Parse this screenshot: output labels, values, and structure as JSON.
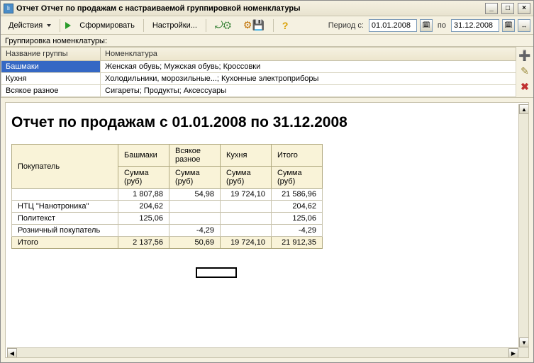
{
  "window": {
    "title": "Отчет  Отчет по продажам с настраиваемой группировкой номенклатуры"
  },
  "toolbar": {
    "actions_label": "Действия",
    "form_label": "Сформировать",
    "settings_label": "Настройки...",
    "period_label": "Период с:",
    "period_to": "по",
    "date_from": "01.01.2008",
    "date_to": "31.12.2008"
  },
  "grouping": {
    "caption": "Группировка номенклатуры:",
    "col_group": "Название группы",
    "col_nomen": "Номенклатура",
    "rows": [
      {
        "name": "Башмаки",
        "items": "Женская обувь; Мужская обувь; Кроссовки"
      },
      {
        "name": "Кухня",
        "items": "Холодильники, морозильные...; Кухонные электроприборы"
      },
      {
        "name": "Всякое разное",
        "items": "Сигареты; Продукты; Аксессуары"
      }
    ]
  },
  "report": {
    "title": "Отчет по продажам с 01.01.2008 по 31.12.2008",
    "buyer_header": "Покупатель",
    "sum_label": "Сумма (руб)",
    "columns": [
      "Башмаки",
      "Всякое разное",
      "Кухня",
      "Итого"
    ],
    "rows": [
      {
        "buyer": "",
        "vals": [
          "1 807,88",
          "54,98",
          "19 724,10",
          "21 586,96"
        ]
      },
      {
        "buyer": "НТЦ \"Нанотроника\"",
        "vals": [
          "204,62",
          "",
          "",
          "204,62"
        ]
      },
      {
        "buyer": "Политекст",
        "vals": [
          "125,06",
          "",
          "",
          "125,06"
        ]
      },
      {
        "buyer": "Розничный покупатель",
        "vals": [
          "",
          "-4,29",
          "",
          "-4,29"
        ]
      }
    ],
    "total_label": "Итого",
    "totals": [
      "2 137,56",
      "50,69",
      "19 724,10",
      "21 912,35"
    ]
  },
  "chart_data": {
    "type": "table",
    "title": "Отчет по продажам с 01.01.2008 по 31.12.2008",
    "row_field": "Покупатель",
    "value_label": "Сумма (руб)",
    "columns": [
      "Башмаки",
      "Всякое разное",
      "Кухня",
      "Итого"
    ],
    "rows": [
      {
        "buyer": "(пусто)",
        "Башмаки": 1807.88,
        "Всякое разное": 54.98,
        "Кухня": 19724.1,
        "Итого": 21586.96
      },
      {
        "buyer": "НТЦ \"Нанотроника\"",
        "Башмаки": 204.62,
        "Всякое разное": null,
        "Кухня": null,
        "Итого": 204.62
      },
      {
        "buyer": "Политекст",
        "Башмаки": 125.06,
        "Всякое разное": null,
        "Кухня": null,
        "Итого": 125.06
      },
      {
        "buyer": "Розничный покупатель",
        "Башмаки": null,
        "Всякое разное": -4.29,
        "Кухня": null,
        "Итого": -4.29
      }
    ],
    "totals": {
      "Башмаки": 2137.56,
      "Всякое разное": 50.69,
      "Кухня": 19724.1,
      "Итого": 21912.35
    }
  }
}
